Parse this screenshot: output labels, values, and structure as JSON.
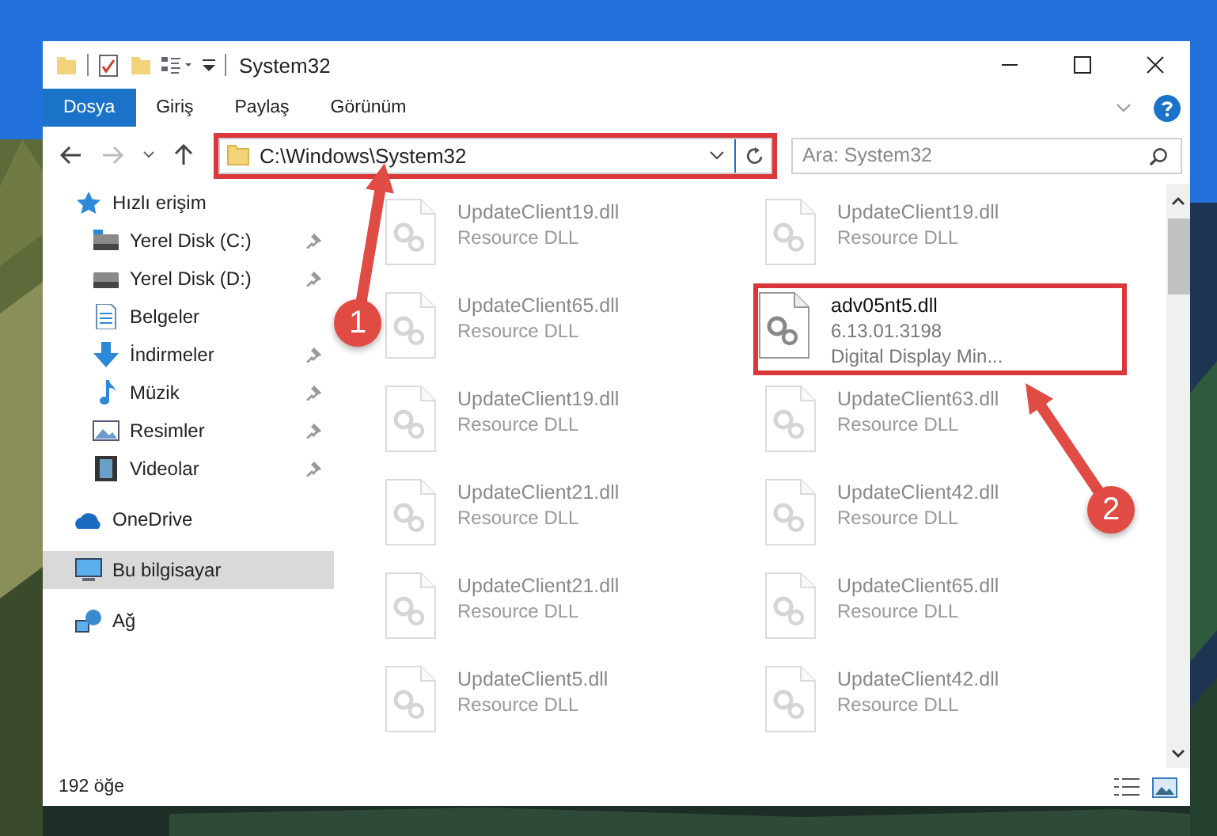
{
  "window": {
    "title": "System32"
  },
  "ribbon_tabs": [
    {
      "label": "Dosya",
      "selected": true
    },
    {
      "label": "Giriş",
      "selected": false
    },
    {
      "label": "Paylaş",
      "selected": false
    },
    {
      "label": "Görünüm",
      "selected": false
    }
  ],
  "address": {
    "path": "C:\\Windows\\System32",
    "highlighted": true
  },
  "search": {
    "placeholder": "Ara: System32"
  },
  "sidebar": {
    "items": [
      {
        "label": "Hızlı erişim",
        "kind": "star",
        "pinned": false,
        "selected": false,
        "top": true
      },
      {
        "label": "Yerel Disk (C:)",
        "kind": "system-drive",
        "pinned": true,
        "selected": false,
        "top": false
      },
      {
        "label": "Yerel Disk (D:)",
        "kind": "drive",
        "pinned": true,
        "selected": false,
        "top": false
      },
      {
        "label": "Belgeler",
        "kind": "documents",
        "pinned": false,
        "selected": false,
        "top": false
      },
      {
        "label": "İndirmeler",
        "kind": "download",
        "pinned": true,
        "selected": false,
        "top": false
      },
      {
        "label": "Müzik",
        "kind": "music",
        "pinned": true,
        "selected": false,
        "top": false
      },
      {
        "label": "Resimler",
        "kind": "pictures",
        "pinned": true,
        "selected": false,
        "top": false
      },
      {
        "label": "Videolar",
        "kind": "video",
        "pinned": true,
        "selected": false,
        "top": false
      },
      {
        "label": "OneDrive",
        "kind": "cloud",
        "pinned": false,
        "selected": false,
        "top": true
      },
      {
        "label": "Bu bilgisayar",
        "kind": "computer",
        "pinned": false,
        "selected": true,
        "top": true
      },
      {
        "label": "Ağ",
        "kind": "network",
        "pinned": false,
        "selected": false,
        "top": true
      }
    ]
  },
  "files": [
    {
      "lines": [
        "UpdateClient19.dll",
        "Resource DLL"
      ],
      "faded": true,
      "highlighted": false
    },
    {
      "lines": [
        "UpdateClient19.dll",
        "Resource DLL"
      ],
      "faded": true,
      "highlighted": false
    },
    {
      "lines": [
        "UpdateClient65.dll",
        "Resource DLL"
      ],
      "faded": true,
      "highlighted": false
    },
    {
      "lines": [
        "adv05nt5.dll",
        "6.13.01.3198",
        "Digital Display Min..."
      ],
      "faded": false,
      "highlighted": true
    },
    {
      "lines": [
        "UpdateClient19.dll",
        "Resource DLL"
      ],
      "faded": true,
      "highlighted": false
    },
    {
      "lines": [
        "UpdateClient63.dll",
        "Resource DLL"
      ],
      "faded": true,
      "highlighted": false
    },
    {
      "lines": [
        "UpdateClient21.dll",
        "Resource DLL"
      ],
      "faded": true,
      "highlighted": false
    },
    {
      "lines": [
        "UpdateClient42.dll",
        "Resource DLL"
      ],
      "faded": true,
      "highlighted": false
    },
    {
      "lines": [
        "UpdateClient21.dll",
        "Resource DLL"
      ],
      "faded": true,
      "highlighted": false
    },
    {
      "lines": [
        "UpdateClient65.dll",
        "Resource DLL"
      ],
      "faded": true,
      "highlighted": false
    },
    {
      "lines": [
        "UpdateClient5.dll",
        "Resource DLL"
      ],
      "faded": true,
      "highlighted": false
    },
    {
      "lines": [
        "UpdateClient42.dll",
        "Resource DLL"
      ],
      "faded": true,
      "highlighted": false
    }
  ],
  "status_bar": {
    "count": "192 öğe"
  },
  "annotations": [
    {
      "label": "1"
    },
    {
      "label": "2"
    }
  ]
}
